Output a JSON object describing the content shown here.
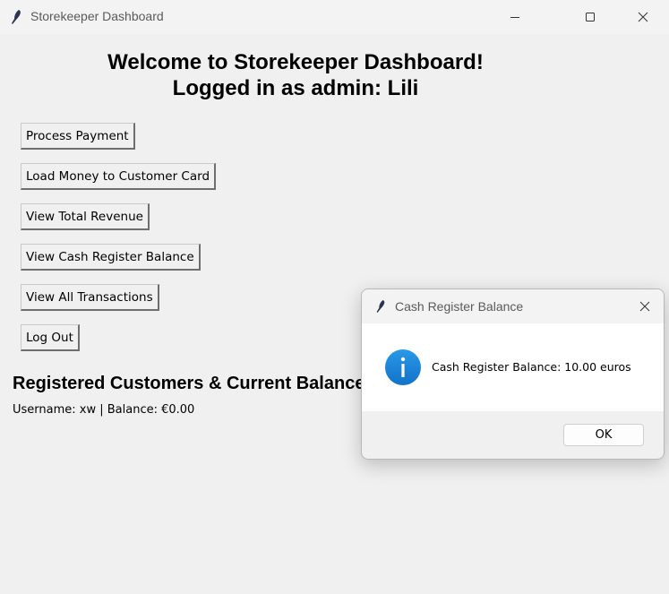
{
  "window": {
    "title": "Storekeeper Dashboard",
    "icon": "feather-icon"
  },
  "heading": {
    "line1": "Welcome to Storekeeper Dashboard!",
    "line2": "Logged in as admin: Lili"
  },
  "buttons": [
    {
      "label": "Process Payment"
    },
    {
      "label": "Load Money to Customer Card"
    },
    {
      "label": "View Total Revenue"
    },
    {
      "label": "View Cash Register Balance"
    },
    {
      "label": "View All Transactions"
    },
    {
      "label": "Log Out"
    }
  ],
  "customers": {
    "title": "Registered Customers & Current Balance",
    "lines": [
      "Username: xw | Balance: €0.00"
    ]
  },
  "dialog": {
    "title": "Cash Register Balance",
    "icon": "info-icon",
    "message": "Cash Register Balance: 10.00 euros",
    "ok_label": "OK"
  },
  "colors": {
    "window_bg": "#f0f0f0",
    "info_icon": "#1a82d6"
  }
}
